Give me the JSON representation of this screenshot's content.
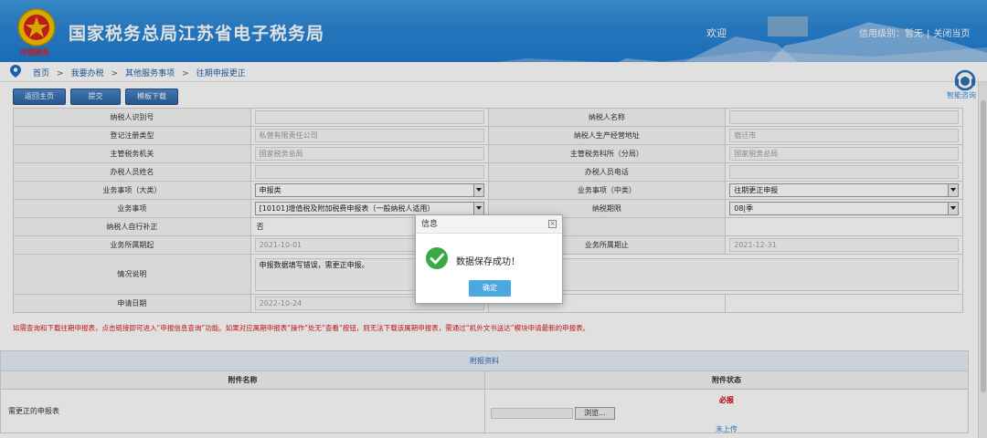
{
  "header": {
    "emblem_caption": "中国税务",
    "site_title": "国家税务总局江苏省电子税务局",
    "welcome": "欢迎",
    "credit_label": "信用级别：暂无",
    "separator": "|",
    "close_page": "关闭当页"
  },
  "breadcrumb": {
    "items": [
      "首页",
      "我要办税",
      "其他服务事项",
      "往期申报更正"
    ],
    "separator": ">"
  },
  "assistant": {
    "label": "智能咨询",
    "icon": "headset-icon"
  },
  "toolbar": {
    "back_home": "返回主页",
    "submit": "提交",
    "template_download": "模板下载"
  },
  "form": {
    "rows": [
      {
        "l1": "纳税人识别号",
        "v1": "",
        "l2": "纳税人名称",
        "v2": ""
      },
      {
        "l1": "登记注册类型",
        "v1": "私营有限责任公司",
        "l2": "纳税人生产经营地址",
        "v2": "宿迁市"
      },
      {
        "l1": "主管税务机关",
        "v1": "国家税务总局",
        "l2": "主管税务科所（分局）",
        "v2": "国家税务总局"
      },
      {
        "l1": "办税人员姓名",
        "v1": "",
        "l2": "办税人员电话",
        "v2": ""
      },
      {
        "l1": "业务事项（大类）",
        "v1": "申报类",
        "l2": "业务事项（中类）",
        "v2": "往期更正申报"
      },
      {
        "l1": "业务事项",
        "v1": "[10101]增值税及附加税费申报表（一般纳税人适用）",
        "l2": "纳税期限",
        "v2": "08|季"
      },
      {
        "l1": "纳税人自行补正",
        "v1": "否",
        "l2": "",
        "v2": ""
      },
      {
        "l1": "业务所属期起",
        "v1": "2021-10-01",
        "l2": "业务所属期止",
        "v2": "2021-12-31"
      },
      {
        "l1": "情况说明",
        "v1": "申报数据填写错误，需更正申报。",
        "l2": "",
        "v2": ""
      },
      {
        "l1": "申请日期",
        "v1": "2022-10-24",
        "l2": "",
        "v2": ""
      }
    ]
  },
  "notice": "如需查询和下载往期申报表，点击链接即可进入“申报信息查询”功能。如果对应属期申报表“操作”处无“查看”按钮，则无法下载该属期申报表，需通过“机外文书送达”模块申请最新的申报表。",
  "attachments": {
    "title": "附报资料",
    "col_name": "附件名称",
    "col_status": "附件状态",
    "rows": [
      {
        "name": "需更正的申报表",
        "required": "必报",
        "browse": "浏览...",
        "status": "未上传"
      }
    ]
  },
  "dialog": {
    "title": "信息",
    "close": "×",
    "message": "数据保存成功！",
    "ok": "确定",
    "icon": "check-circle-icon"
  },
  "colors": {
    "header_blue": "#2b86d6",
    "button_blue": "#2c62a4",
    "link_blue": "#1d5fa8",
    "notice_red": "#d91a1a",
    "success_green": "#3aa843",
    "ok_button": "#4aa8e0"
  }
}
